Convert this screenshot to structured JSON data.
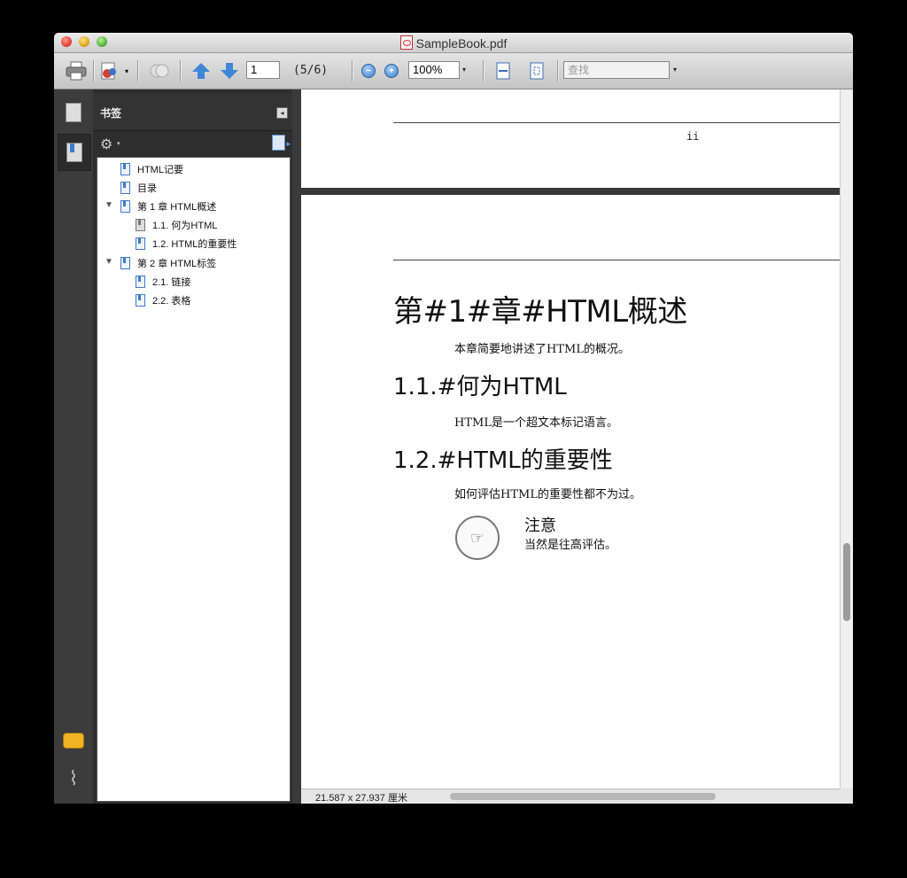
{
  "window": {
    "title": "SampleBook.pdf"
  },
  "toolbar": {
    "page_value": "1",
    "page_count": "(5/6)",
    "zoom_value": "100%",
    "search_placeholder": "查找"
  },
  "sidebar": {
    "panel_title": "书签",
    "bookmarks": [
      {
        "label": "HTML记要"
      },
      {
        "label": "目录"
      },
      {
        "label": "第 1 章 HTML概述"
      },
      {
        "label": "1.1. 何为HTML"
      },
      {
        "label": "1.2. HTML的重要性"
      },
      {
        "label": "第 2 章 HTML标签"
      },
      {
        "label": "2.1. 链接"
      },
      {
        "label": "2.2. 表格"
      }
    ]
  },
  "document": {
    "page_number_prev": "ii",
    "chapter_title": "第#1#章#HTML概述",
    "chapter_intro": "本章简要地讲述了HTML的概况。",
    "section1_title": "1.1.#何为HTML",
    "section1_body": "HTML是一个超文本标记语言。",
    "section2_title": "1.2.#HTML的重要性",
    "section2_body": "如何评估HTML的重要性都不为过。",
    "note_title": "注意",
    "note_body": "当然是往高评估。"
  },
  "status": {
    "page_size": "21.587 x 27.937 厘米"
  }
}
